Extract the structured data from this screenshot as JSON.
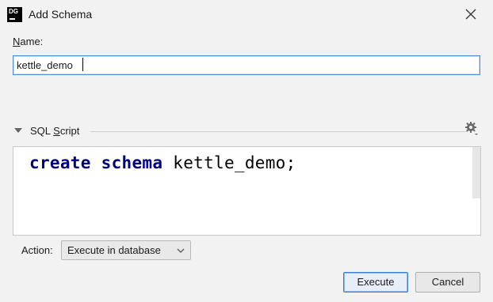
{
  "window": {
    "title": "Add Schema",
    "app_icon_text": "DG"
  },
  "name_field": {
    "label_first": "N",
    "label_rest": "ame:",
    "value": "kettle_demo"
  },
  "sql_section": {
    "title_prefix": "SQL ",
    "title_underlined": "S",
    "title_suffix": "cript",
    "code_keyword1": "create",
    "code_keyword2": "schema",
    "code_ident": "kettle_demo;"
  },
  "action": {
    "label": "Action:",
    "selected": "Execute in database"
  },
  "buttons": {
    "execute": "Execute",
    "cancel": "Cancel"
  },
  "colors": {
    "focus_border": "#4a8fd6",
    "keyword": "#000080",
    "default_button_border": "#3b7fd3"
  },
  "icons": {
    "close": "close-icon",
    "gear": "gear-icon",
    "toggle": "triangle-down-icon",
    "dropdown": "chevron-down-icon"
  }
}
